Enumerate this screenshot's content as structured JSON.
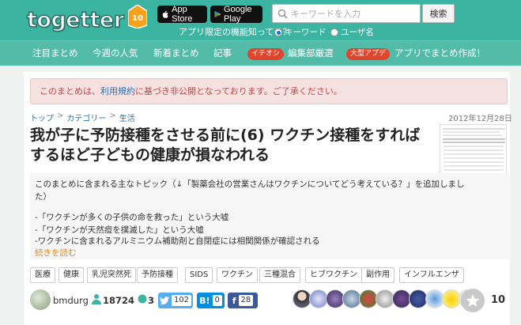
{
  "header": {
    "logo_text": "togetter",
    "logo_badge": "10",
    "app_store_label": "App Store",
    "google_play_label": "Google Play",
    "app_note": "アプリ限定の機能知ってる？",
    "search_placeholder": "キーワードを入力",
    "search_button": "検索",
    "radio_keyword": "キーワード",
    "radio_user": "ユーザ名",
    "radio_selected": "キーワード"
  },
  "nav": {
    "items": [
      "注目まとめ",
      "今週の人気",
      "新着まとめ",
      "記事",
      "編集部厳選",
      "アプリでまとめ作成！"
    ],
    "pills": [
      "イチオシ",
      "大型アプデ"
    ]
  },
  "notice": {
    "before": "このまとめは、",
    "link": "利用規約",
    "after": "に基づき非公開となっております。ご了承ください。"
  },
  "breadcrumb": [
    "トップ",
    "カテゴリー",
    "生活"
  ],
  "date": "2012年12月28日",
  "title": "我が子に予防接種をさせる前に(6) ワクチン接種をすればするほど子どもの健康が損なわれる",
  "description": {
    "lines": [
      "このまとめに含まれる主なトピック（↓「製薬会社の営業さんはワクチンについてどう考えている？」を追加しまし",
      "た）",
      "-「ワクチンが多くの子供の命を救った」という大嘘",
      "-「ワクチンが天然痘を撲滅した」という大嘘",
      "-ワクチンに含まれるアルミニウム補助剤と自閉症には相関関係が確認される"
    ],
    "more_label": "続きを読む"
  },
  "tags": [
    "医療",
    "健康",
    "乳児突然死",
    "予防接種",
    "SIDS",
    "ワクチン",
    "三種混合",
    "ヒブワクチン",
    "副作用",
    "インフルエンザ"
  ],
  "user": {
    "name": "bmdurg",
    "views": "18724",
    "comments": "3",
    "twitter_count": "102",
    "hatena_count": "0",
    "facebook_count": "28",
    "favorites": "10"
  },
  "colors": {
    "header_bg": "#3cb4a2",
    "nav_bg": "#53bca9",
    "notice_bg": "#f6e1e1",
    "notice_text": "#b94a48",
    "link": "#2a6fb5",
    "twitter": "#55acee",
    "hatena": "#008fde",
    "facebook": "#3b5998"
  }
}
